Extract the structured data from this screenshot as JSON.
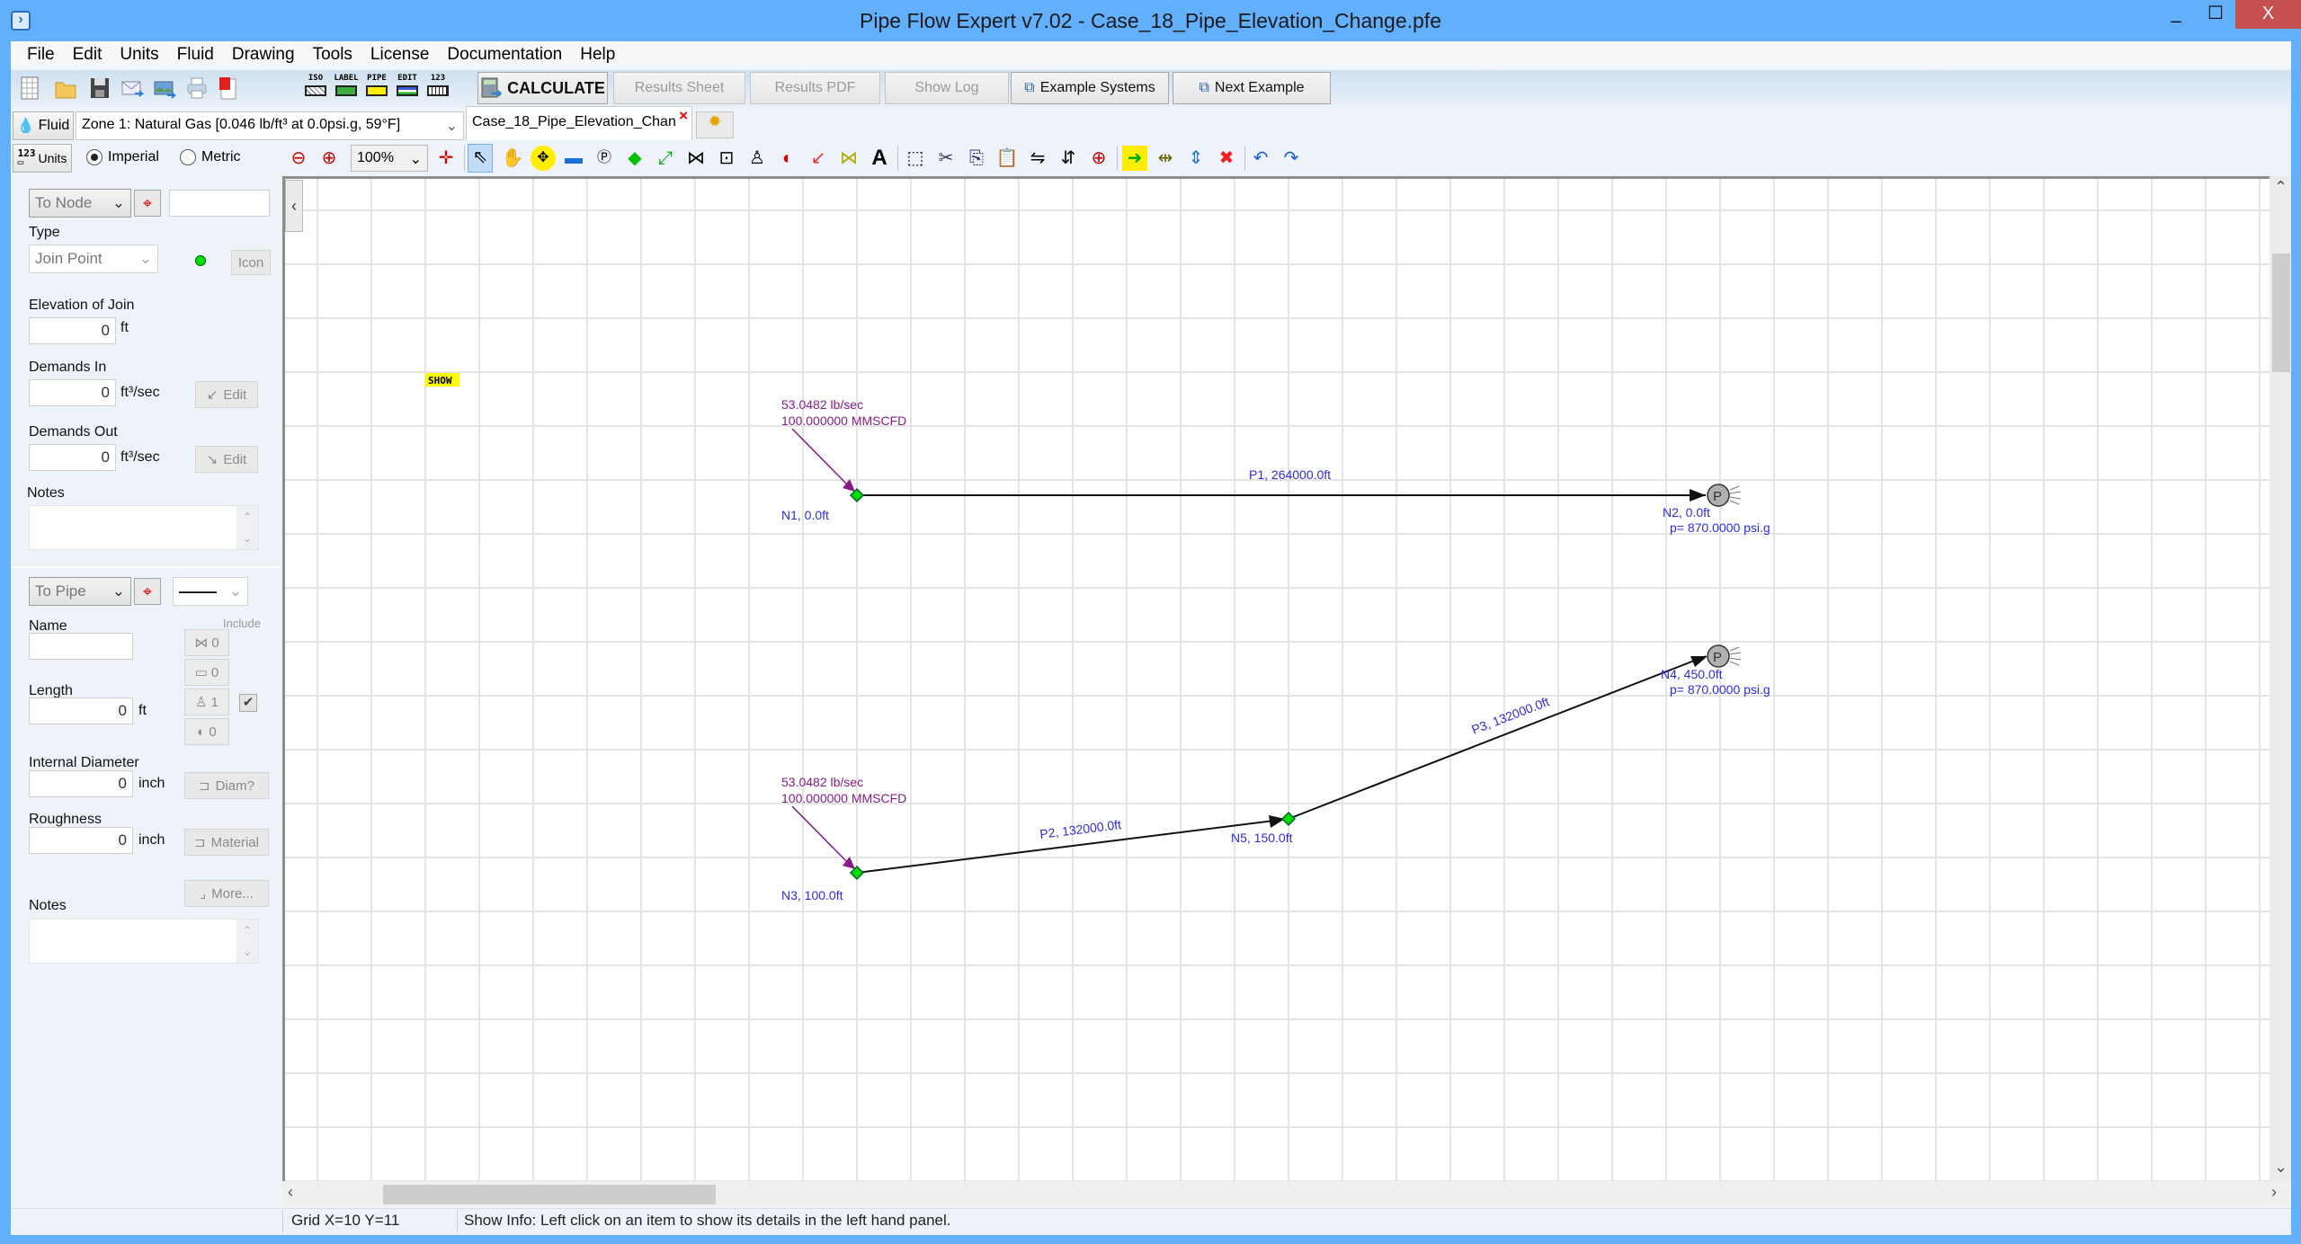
{
  "window": {
    "title": "Pipe Flow Expert v7.02 - Case_18_Pipe_Elevation_Change.pfe",
    "minimize_glyph": "_",
    "maximize_glyph": "☐",
    "close_glyph": "X"
  },
  "menu": [
    "File",
    "Edit",
    "Units",
    "Fluid",
    "Drawing",
    "Tools",
    "License",
    "Documentation",
    "Help"
  ],
  "toolbar": {
    "file_icons": [
      "new-grid-icon",
      "open-folder-icon",
      "save-icon",
      "email-icon",
      "export-image-icon",
      "print-icon",
      "pdf-icon"
    ],
    "label_icons": [
      {
        "name": "iso-icon",
        "label": "ISO"
      },
      {
        "name": "label-icon",
        "label": "LABEL"
      },
      {
        "name": "pipe-icon",
        "label": "PIPE"
      },
      {
        "name": "edit-icon",
        "label": "EDIT"
      },
      {
        "name": "units-123-icon",
        "label": "123"
      }
    ],
    "calculate_label": "CALCULATE",
    "results_sheet_label": "Results Sheet",
    "results_pdf_label": "Results PDF",
    "show_log_label": "Show Log",
    "example_systems_label": "Example Systems",
    "next_example_label": "Next Example"
  },
  "fluid": {
    "button_label": "Fluid",
    "zone_value": "Zone 1: Natural Gas [0.046 lb/ft³ at 0.0psi.g, 59°F]"
  },
  "document_tab": {
    "label": "Case_18_Pipe_Elevation_Chan",
    "close_glyph": "×"
  },
  "units": {
    "button_label": "Units",
    "options": [
      {
        "label": "Imperial",
        "selected": true
      },
      {
        "label": "Metric",
        "selected": false
      }
    ]
  },
  "drawing_toolbar": {
    "zoom_level": "100%",
    "tools": [
      "zoom-out-icon",
      "zoom-in-icon",
      "center-icon",
      "select-arrow-icon",
      "pan-hand-icon",
      "move-icon",
      "tank-icon",
      "pressure-node-icon",
      "join-point-icon",
      "add-pipe-icon",
      "fittings-icon",
      "component-icon",
      "control-valve-icon",
      "pump-icon",
      "demand-icon",
      "flow-icon",
      "text-icon",
      "select-area-icon",
      "cut-icon",
      "copy-icon",
      "paste-icon",
      "flip-horizontal-icon",
      "flip-vertical-icon",
      "zoom-area-icon",
      "add-node-icon",
      "align-icon",
      "distribute-icon",
      "delete-icon",
      "undo-icon",
      "redo-icon"
    ]
  },
  "node_panel": {
    "selector_value": "To Node",
    "name_value": "",
    "type_label": "Type",
    "type_value": "Join Point",
    "icon_button_label": "Icon",
    "elevation_label": "Elevation of Join",
    "elevation_value": "0",
    "elevation_unit": "ft",
    "demands_in_label": "Demands In",
    "demands_in_value": "0",
    "demands_in_unit": "ft³/sec",
    "demands_out_label": "Demands Out",
    "demands_out_value": "0",
    "demands_out_unit": "ft³/sec",
    "edit_label": "Edit",
    "notes_label": "Notes",
    "notes_value": ""
  },
  "pipe_panel": {
    "selector_value": "To Pipe",
    "name_label": "Name",
    "name_value": "",
    "include_label": "Include",
    "fittings_count": "0",
    "components_count": "0",
    "valves_count": "1",
    "valves_included": true,
    "pumps_count": "0",
    "length_label": "Length",
    "length_value": "0",
    "length_unit": "ft",
    "diameter_label": "Internal Diameter",
    "diameter_value": "0",
    "diameter_unit": "inch",
    "diam_button_label": "Diam?",
    "roughness_label": "Roughness",
    "roughness_value": "0",
    "roughness_unit": "inch",
    "material_button_label": "Material",
    "more_button_label": "More...",
    "notes_label": "Notes",
    "notes_value": ""
  },
  "canvas": {
    "show_marker": "SHOW",
    "colors": {
      "label_blue": "#2b2bf0",
      "flow_purple": "#8a1a8a",
      "join_green": "#00e000",
      "grid": "#e4e4e4",
      "pipe": "#111111",
      "show_yellow": "#ffff00"
    },
    "nodes": [
      {
        "id": "N1",
        "label": "N1, 0.0ft",
        "type": "join"
      },
      {
        "id": "N2",
        "label": "N2, 0.0ft",
        "type": "pressure",
        "pressure": "p= 870.0000 psi.g"
      },
      {
        "id": "N3",
        "label": "N3, 100.0ft",
        "type": "join"
      },
      {
        "id": "N4",
        "label": "N4, 450.0ft",
        "type": "pressure",
        "pressure": "p= 870.0000 psi.g"
      },
      {
        "id": "N5",
        "label": "N5, 150.0ft",
        "type": "join"
      }
    ],
    "pipes": [
      {
        "id": "P1",
        "label": "P1, 264000.0ft",
        "from": "N1",
        "to": "N2"
      },
      {
        "id": "P2",
        "label": "P2, 132000.0ft",
        "from": "N3",
        "to": "N5"
      },
      {
        "id": "P3",
        "label": "P3, 132000.0ft",
        "from": "N5",
        "to": "N4"
      }
    ],
    "flow_demands": [
      {
        "node": "N1",
        "line1": "53.0482 lb/sec",
        "line2": "100.000000 MMSCFD"
      },
      {
        "node": "N3",
        "line1": "53.0482 lb/sec",
        "line2": "100.000000 MMSCFD"
      }
    ]
  },
  "status": {
    "grid": "Grid  X=10  Y=11",
    "info": "Show Info: Left click on an item to show its details in the left hand panel."
  }
}
